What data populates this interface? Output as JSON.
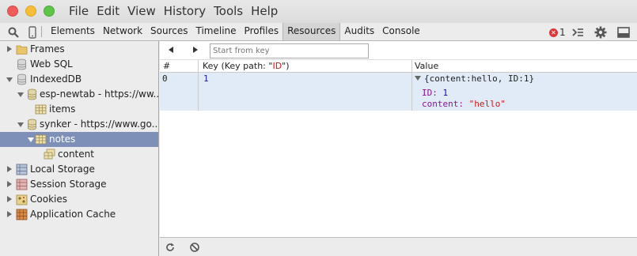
{
  "menu": [
    "File",
    "Edit",
    "View",
    "History",
    "Tools",
    "Help"
  ],
  "toolbar": {
    "tabs": [
      "Elements",
      "Network",
      "Sources",
      "Timeline",
      "Profiles",
      "Resources",
      "Audits",
      "Console"
    ],
    "active_tab": "Resources",
    "error_count": "1",
    "icons": [
      "search-icon",
      "device-mode-icon",
      "console-drawer-icon",
      "settings-gear-icon",
      "dock-icon"
    ]
  },
  "sidebar": {
    "items": [
      {
        "label": "Frames",
        "icon": "folder-icon"
      },
      {
        "label": "Web SQL",
        "icon": "database-icon"
      },
      {
        "label": "IndexedDB",
        "icon": "database-icon"
      },
      {
        "label": "esp-newtab - https://ww...",
        "icon": "database-icon"
      },
      {
        "label": "items",
        "icon": "table-icon"
      },
      {
        "label": "synker - https://www.go...",
        "icon": "database-icon"
      },
      {
        "label": "notes",
        "icon": "table-icon"
      },
      {
        "label": "content",
        "icon": "index-icon"
      },
      {
        "label": "Local Storage",
        "icon": "storage-grid-icon"
      },
      {
        "label": "Session Storage",
        "icon": "storage-grid-icon"
      },
      {
        "label": "Cookies",
        "icon": "cookie-icon"
      },
      {
        "label": "Application Cache",
        "icon": "app-cache-icon"
      }
    ]
  },
  "main": {
    "start_placeholder": "Start from key",
    "columns": {
      "index": "#",
      "key_prefix": "Key (Key path: \"",
      "key_path": "ID",
      "key_suffix": "\")",
      "value": "Value"
    },
    "row": {
      "index": "0",
      "key": "1",
      "summary": "{content:hello, ID:1}",
      "id_label": "ID:",
      "id_value": "1",
      "content_label": "content:",
      "content_value": "\"hello\""
    }
  }
}
